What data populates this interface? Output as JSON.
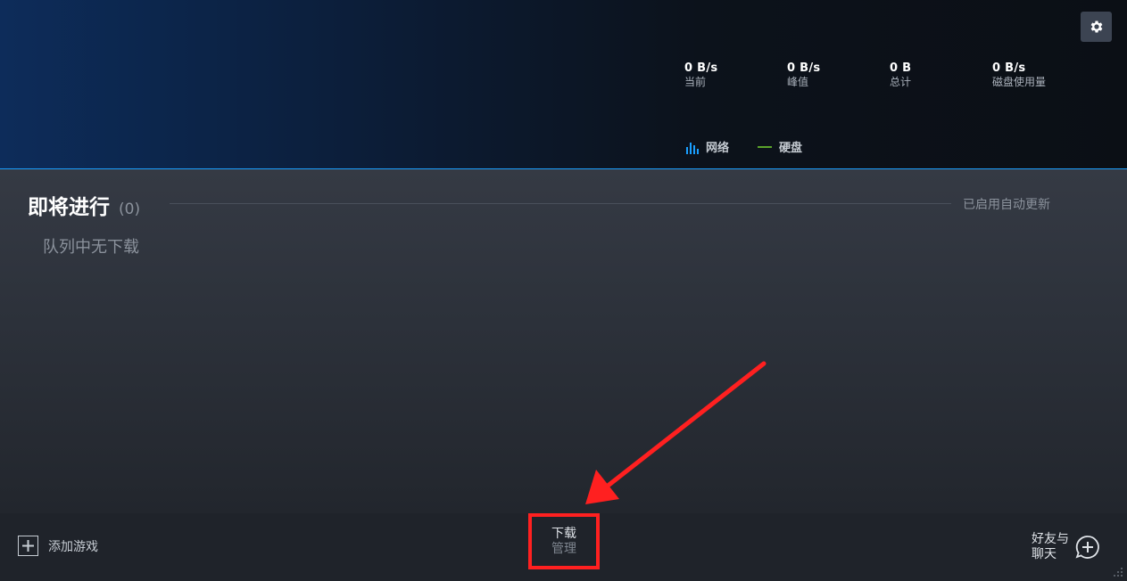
{
  "stats": [
    {
      "value": "0 B/s",
      "label": "当前"
    },
    {
      "value": "0 B/s",
      "label": "峰值"
    },
    {
      "value": "0 B",
      "label": "总计"
    },
    {
      "value": "0 B/s",
      "label": "磁盘使用量"
    }
  ],
  "legend": {
    "network_label": "网络",
    "disk_label": "硬盘",
    "network_color": "#1a9fff",
    "disk_color": "#5ba32b"
  },
  "section": {
    "title": "即将进行",
    "count": "(0)",
    "auto_update": "已启用自动更新",
    "empty_message": "队列中无下载"
  },
  "footer": {
    "add_game_label": "添加游戏",
    "downloads_line1": "下载",
    "downloads_line2": "管理",
    "friends_line1": "好友与",
    "friends_line2": "聊天"
  },
  "icons": {
    "settings": "gear-icon",
    "add_game": "plus-icon",
    "friends": "chat-plus-icon",
    "network": "bar-chart-icon",
    "disk": "line-icon"
  },
  "colors": {
    "accent": "#1a9fff",
    "annotation": "#ff2020"
  }
}
